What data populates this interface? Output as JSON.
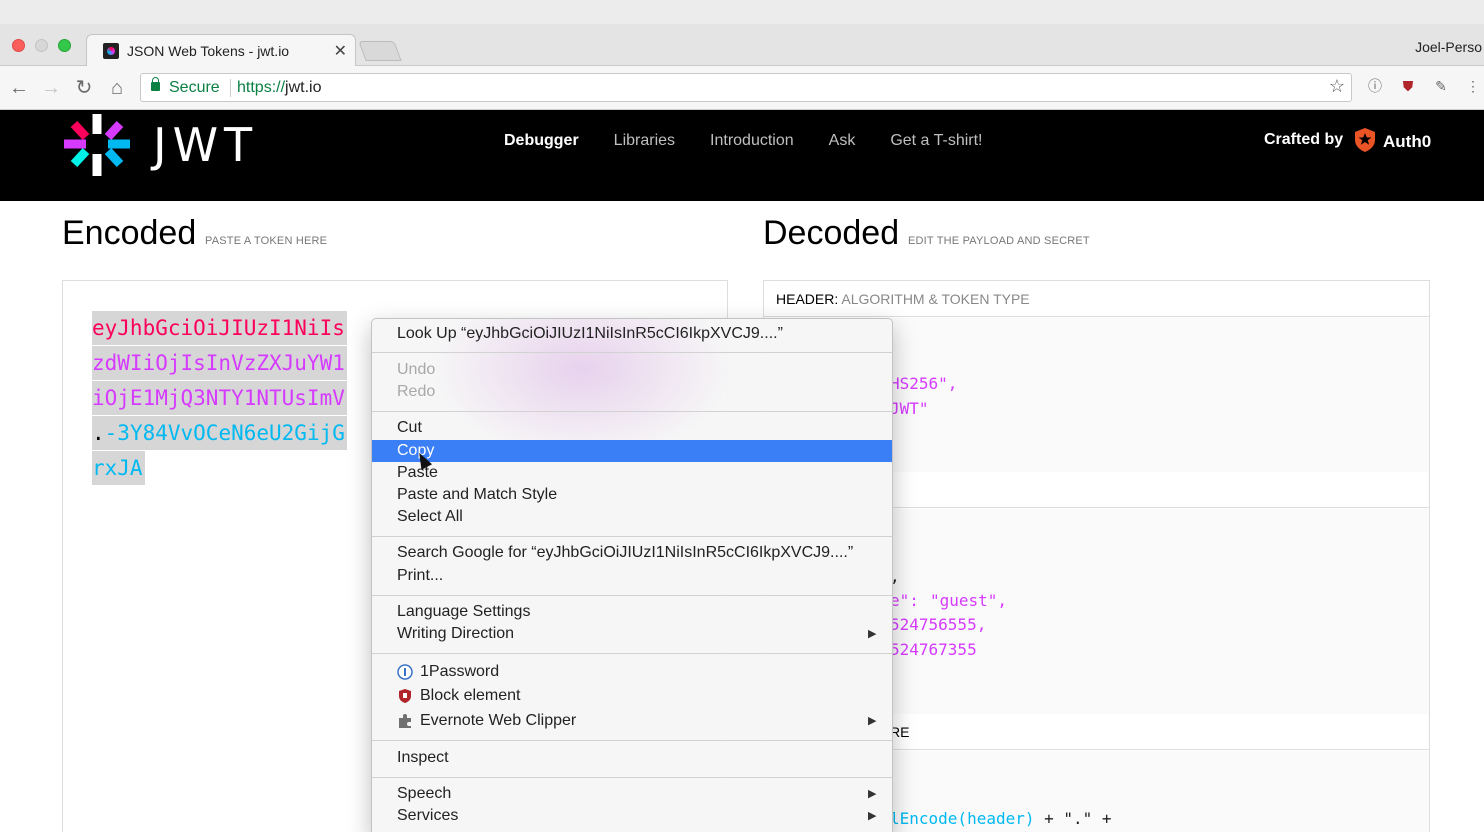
{
  "browser": {
    "tab_title": "JSON Web Tokens - jwt.io",
    "tab_close": "✕",
    "profile_name": "Joel-Perso",
    "secure_label": "Secure",
    "url_scheme": "https://",
    "url_host": "jwt.io",
    "icons": [
      "back-icon",
      "forward-icon",
      "reload-icon",
      "home-icon",
      "lock-icon",
      "star-icon",
      "onepassword-icon",
      "ublock-icon",
      "evernote-icon",
      "menu-icon"
    ]
  },
  "site": {
    "logo_text": "JWT",
    "nav": [
      "Debugger",
      "Libraries",
      "Introduction",
      "Ask",
      "Get a T-shirt!"
    ],
    "active_nav": "Debugger",
    "crafted_by": "Crafted by",
    "brand": "Auth0"
  },
  "encoded": {
    "title": "Encoded",
    "hint": "PASTE A TOKEN HERE",
    "lines": [
      {
        "red": "eyJhbGciOiJIUzI1NiIs",
        "purple": "",
        "dot": "",
        "blue": ""
      },
      {
        "red": "",
        "purple": "zdWIiOjIsInVzZXJuYW1",
        "dot": "",
        "blue": ""
      },
      {
        "red": "",
        "purple": "iOjE1MjQ3NTY1NTUsImV",
        "dot": "",
        "blue": ""
      },
      {
        "red": "",
        "purple": "",
        "dot": ".",
        "blue": "-3Y84VvOCeN6eU2GijG"
      },
      {
        "red": "",
        "purple": "",
        "dot": "",
        "blue": "rxJA"
      }
    ]
  },
  "decoded": {
    "title": "Decoded",
    "hint": "EDIT THE PAYLOAD AND SECRET",
    "header_label": "HEADER:",
    "header_sub": "ALGORITHM & TOKEN TYPE",
    "header_alg": "HS256\",",
    "header_typ": "JWT\"",
    "payload_comma": ",",
    "payload_role_key": "e\": ",
    "payload_role_val": "\"guest\",",
    "payload_iat": "524756555,",
    "payload_exp": "524767355",
    "signature_label": "RE",
    "signature_code_fn": "lEncode(header)",
    "signature_code_rest": " + \".\" +"
  },
  "context_menu": {
    "look_up": "Look Up “eyJhbGciOiJIUzI1NiIsInR5cCI6IkpXVCJ9....”",
    "undo": "Undo",
    "redo": "Redo",
    "cut": "Cut",
    "copy": "Copy",
    "paste": "Paste",
    "paste_match": "Paste and Match Style",
    "select_all": "Select All",
    "search_google": "Search Google for “eyJhbGciOiJIUzI1NiIsInR5cCI6IkpXVCJ9....”",
    "print": "Print...",
    "language_settings": "Language Settings",
    "writing_direction": "Writing Direction",
    "onepassword": "1Password",
    "block_element": "Block element",
    "evernote": "Evernote Web Clipper",
    "inspect": "Inspect",
    "speech": "Speech",
    "services": "Services",
    "submenu_arrow": "▶"
  },
  "colors": {
    "token_red": "#fb015b",
    "token_purple": "#d63aff",
    "token_blue": "#00b9f1",
    "menu_highlight": "#3a7ff6"
  }
}
